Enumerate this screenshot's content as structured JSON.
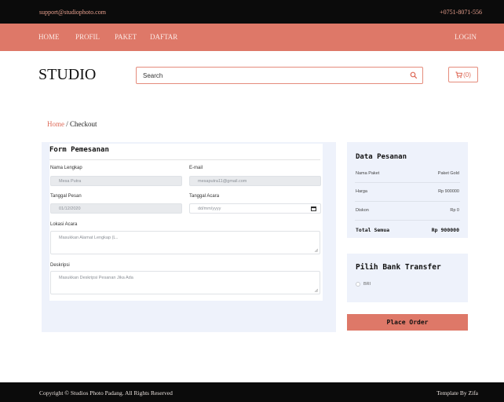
{
  "topbar": {
    "email": "support@studiophoto.com",
    "phone": "+0751-8071-556"
  },
  "nav": {
    "items": [
      "HOME",
      "PROFIL",
      "PAKET",
      "DAFTAR"
    ],
    "login": "LOGIN"
  },
  "header": {
    "brand": "STUDIO",
    "search_placeholder": "Search",
    "cart_label": "(0)"
  },
  "breadcrumb": {
    "home": "Home",
    "separator": " / ",
    "current": "Checkout"
  },
  "form": {
    "title": "Form Pemesanan",
    "nama_label": "Nama Lengkap",
    "nama_value": "Mesa Putra",
    "email_label": "E-mail",
    "email_value": "mesaputra11@gmail.com",
    "tanggal_pesan_label": "Tanggal Pesan",
    "tanggal_pesan_value": "01/12/2020",
    "tanggal_acara_label": "Tanggal Acara",
    "tanggal_acara_placeholder": "dd/mm/yyyy",
    "lokasi_label": "Lokasi Acara",
    "lokasi_placeholder": "Masukkan Alamat Lengkap (L..",
    "deskripsi_label": "Deskripsi",
    "deskripsi_placeholder": "Masukkan Deskripsi Pesanan Jika Ada"
  },
  "order": {
    "title": "Data Pesanan",
    "rows": [
      {
        "label": "Nama Paket",
        "value": "Paket Gold"
      },
      {
        "label": "Harga",
        "value": "Rp 900000"
      },
      {
        "label": "Diskon",
        "value": "Rp 0"
      }
    ],
    "total_label": "Total Semua",
    "total_value": "Rp 900000"
  },
  "bank": {
    "title": "Pilih Bank Transfer",
    "option": "BRI"
  },
  "actions": {
    "place_order": "Place Order"
  },
  "footer": {
    "copyright": "Copyright © Studios Photo Padang. All Rights Reserved",
    "credit": "Template By Zifa"
  },
  "colors": {
    "accent": "#de7868",
    "panel": "#eef2fb",
    "bar": "#0b0b0b"
  }
}
